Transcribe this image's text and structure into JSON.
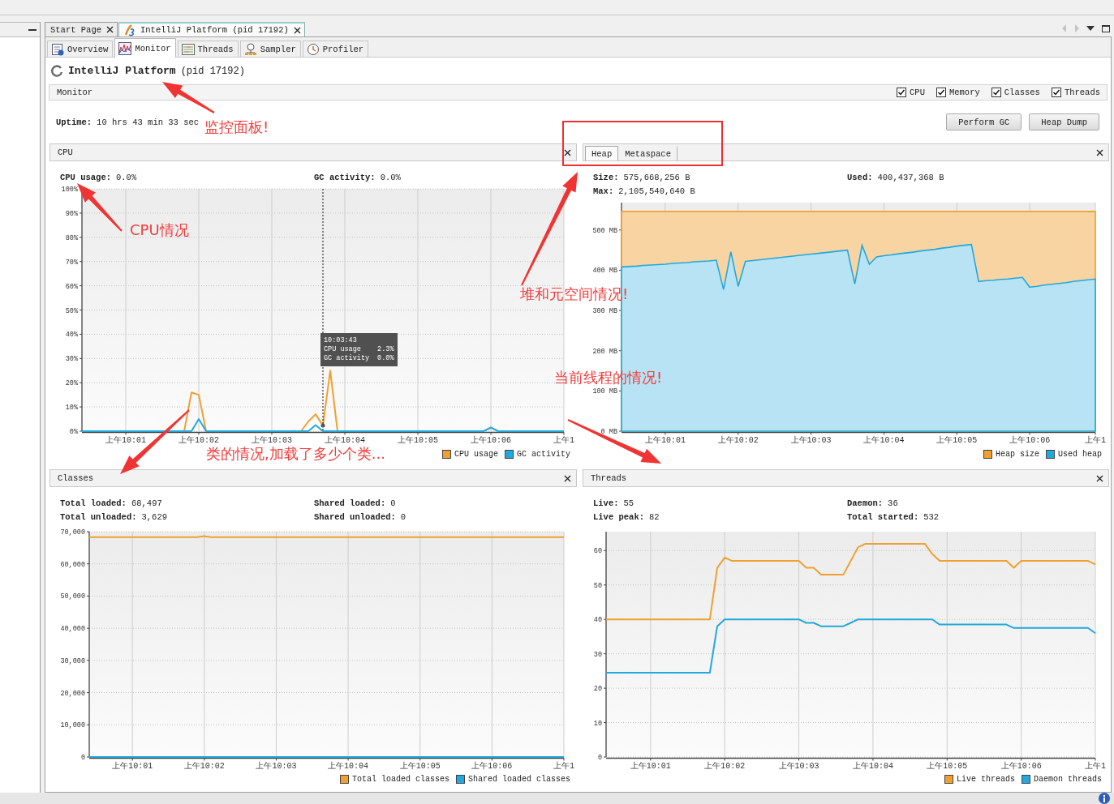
{
  "document_tabs": [
    {
      "label": "Start Page",
      "selected": false,
      "kind": "page"
    },
    {
      "label": "IntelliJ Platform (pid 17192)",
      "selected": true,
      "kind": "application"
    }
  ],
  "view_tabs": [
    {
      "label": "Overview",
      "selected": false,
      "kind": "overview"
    },
    {
      "label": "Monitor",
      "selected": true,
      "kind": "monitor"
    },
    {
      "label": "Threads",
      "selected": false,
      "kind": "threads"
    },
    {
      "label": "Sampler",
      "selected": false,
      "kind": "sampler"
    },
    {
      "label": "Profiler",
      "selected": false,
      "kind": "profiler"
    }
  ],
  "title": {
    "name": "IntelliJ Platform",
    "pid": "(pid 17192)"
  },
  "monitor": {
    "label": "Monitor",
    "options": [
      {
        "label": "CPU",
        "checked": true
      },
      {
        "label": "Memory",
        "checked": true
      },
      {
        "label": "Classes",
        "checked": true
      },
      {
        "label": "Threads",
        "checked": true
      }
    ],
    "uptime_label": "Uptime:",
    "uptime": "10 hrs 43 min 33 sec",
    "buttons": [
      "Perform GC",
      "Heap Dump"
    ]
  },
  "panels": [
    {
      "kind": "cpu",
      "title": "CPU",
      "stats": [
        {
          "label": "CPU usage:",
          "value": "0.0%"
        },
        {
          "label": "GC activity:",
          "value": "0.0%"
        }
      ],
      "chart_data": {
        "type": "line",
        "categories": [
          null,
          null,
          null,
          null,
          null,
          null,
          "上午10:01",
          null,
          null,
          null,
          null,
          null,
          null,
          null,
          null,
          null,
          "上午10:02",
          null,
          null,
          null,
          null,
          null,
          null,
          null,
          null,
          null,
          "上午10:03",
          null,
          null,
          null,
          null,
          null,
          null,
          null,
          null,
          null,
          "上午10:04",
          null,
          null,
          null,
          null,
          null,
          null,
          null,
          null,
          null,
          "上午10:05",
          null,
          null,
          null,
          null,
          null,
          null,
          null,
          null,
          null,
          "上午10:06",
          null,
          null,
          null,
          null,
          null,
          null,
          null,
          null,
          null,
          "上午1"
        ],
        "ylim": [
          0,
          100
        ],
        "series": [
          {
            "name": "CPU usage",
            "color": "#f0a030",
            "values": [
              null,
              null,
              null,
              null,
              null,
              null,
              null,
              null,
              null,
              null,
              null,
              null,
              null,
              null,
              0,
              16,
              15,
              0,
              null,
              null,
              null,
              null,
              null,
              null,
              null,
              null,
              null,
              null,
              null,
              null,
              0,
              4,
              7,
              2.3,
              25,
              0,
              null,
              null,
              null,
              null,
              null,
              null,
              null,
              null,
              null,
              null,
              null,
              null,
              null,
              null,
              null,
              null,
              null,
              null,
              null,
              null,
              null,
              null,
              null,
              null,
              null,
              null,
              null,
              null,
              null,
              null,
              null
            ]
          },
          {
            "name": "GC activity",
            "color": "#22a8dc",
            "values": [
              0,
              0,
              0,
              0,
              0,
              0,
              0,
              0,
              0,
              0,
              0,
              0,
              0,
              0,
              0,
              0,
              5,
              0,
              0,
              0,
              0,
              0,
              0,
              0,
              0,
              0,
              0,
              0,
              0,
              0,
              0,
              0,
              2.5,
              0,
              0,
              0,
              0,
              0,
              0,
              0,
              0,
              0,
              0,
              0,
              0,
              0,
              0,
              0,
              0,
              0,
              0,
              0,
              0,
              0,
              0,
              0,
              1.5,
              0,
              0,
              0,
              0,
              0,
              0,
              0,
              0,
              0,
              0
            ]
          }
        ],
        "yticks": [
          {
            "value": 0,
            "label": "0%"
          },
          {
            "value": 10,
            "label": "10%"
          },
          {
            "value": 20,
            "label": "20%"
          },
          {
            "value": 30,
            "label": "30%"
          },
          {
            "value": 40,
            "label": "40%"
          },
          {
            "value": 50,
            "label": "50%"
          },
          {
            "value": 60,
            "label": "60%"
          },
          {
            "value": 70,
            "label": "70%"
          },
          {
            "value": 80,
            "label": "80%"
          },
          {
            "value": 90,
            "label": "90%"
          },
          {
            "value": 100,
            "label": "100%"
          }
        ],
        "grid": true
      },
      "tooltip": {
        "time": "10:03:43",
        "rows": [
          {
            "label": "CPU usage",
            "value": "2.3%"
          },
          {
            "label": "GC activity",
            "value": "0.0%"
          }
        ]
      }
    },
    {
      "kind": "memory",
      "tabs": [
        {
          "label": "Heap",
          "selected": true
        },
        {
          "label": "Metaspace",
          "selected": false
        }
      ],
      "stats": [
        {
          "label": "Size:",
          "value": "575,668,256 B"
        },
        {
          "label": "Used:",
          "value": "400,437,368 B"
        },
        {
          "label": "Max:",
          "value": "2,105,540,640 B"
        }
      ],
      "chart_data": {
        "type": "area",
        "categories": [
          null,
          null,
          null,
          null,
          null,
          null,
          "上午10:01",
          null,
          null,
          null,
          null,
          null,
          null,
          null,
          null,
          null,
          "上午10:02",
          null,
          null,
          null,
          null,
          null,
          null,
          null,
          null,
          null,
          "上午10:03",
          null,
          null,
          null,
          null,
          null,
          null,
          null,
          null,
          null,
          "上午10:04",
          null,
          null,
          null,
          null,
          null,
          null,
          null,
          null,
          null,
          "上午10:05",
          null,
          null,
          null,
          null,
          null,
          null,
          null,
          null,
          null,
          "上午10:06",
          null,
          null,
          null,
          null,
          null,
          null,
          null,
          null,
          "上午1"
        ],
        "ylim": [
          0,
          568
        ],
        "series": [
          {
            "name": "Heap size",
            "color": "#f0a030",
            "values": [
              546,
              546,
              546,
              546,
              546,
              546,
              546,
              546,
              546,
              546,
              546,
              546,
              546,
              546,
              546,
              546,
              546,
              546,
              546,
              546,
              546,
              546,
              546,
              546,
              546,
              546,
              546,
              546,
              546,
              546,
              546,
              546,
              546,
              546,
              546,
              546,
              546,
              546,
              546,
              546,
              546,
              546,
              546,
              546,
              546,
              546,
              546,
              546,
              546,
              546,
              546,
              546,
              546,
              546,
              546,
              546,
              546,
              546,
              546,
              546,
              546,
              546,
              546,
              546,
              546,
              546
            ]
          },
          {
            "name": "Used heap",
            "color": "#22a8dc",
            "values": [
              408,
              409,
              410,
              412,
              413,
              414,
              415,
              417,
              418,
              419,
              421,
              422,
              423,
              425,
              352,
              446,
              360,
              422,
              424,
              426,
              428,
              430,
              432,
              434,
              436,
              438,
              440,
              442,
              444,
              446,
              448,
              450,
              366,
              462,
              415,
              433,
              436,
              438,
              441,
              443,
              445,
              448,
              450,
              452,
              455,
              457,
              460,
              462,
              464,
              372,
              374,
              375,
              377,
              378,
              380,
              382,
              358,
              360,
              363,
              365,
              367,
              369,
              372,
              374,
              376,
              378
            ]
          }
        ],
        "yticks": [
          {
            "value": 0,
            "label": "0 MB"
          },
          {
            "value": 100,
            "label": "100 MB"
          },
          {
            "value": 200,
            "label": "200 MB"
          },
          {
            "value": 300,
            "label": "300 MB"
          },
          {
            "value": 400,
            "label": "400 MB"
          },
          {
            "value": 500,
            "label": "500 MB"
          }
        ],
        "grid": true
      }
    },
    {
      "kind": "classes",
      "title": "Classes",
      "stats": [
        {
          "label": "Total loaded:",
          "value": "68,497"
        },
        {
          "label": "Shared loaded:",
          "value": "0"
        },
        {
          "label": "Total unloaded:",
          "value": "3,629"
        },
        {
          "label": "Shared unloaded:",
          "value": "0"
        }
      ],
      "chart_data": {
        "type": "line",
        "categories": [
          null,
          null,
          null,
          null,
          null,
          null,
          "上午10:01",
          null,
          null,
          null,
          null,
          null,
          null,
          null,
          null,
          null,
          "上午10:02",
          null,
          null,
          null,
          null,
          null,
          null,
          null,
          null,
          null,
          "上午10:03",
          null,
          null,
          null,
          null,
          null,
          null,
          null,
          null,
          null,
          "上午10:04",
          null,
          null,
          null,
          null,
          null,
          null,
          null,
          null,
          null,
          "上午10:05",
          null,
          null,
          null,
          null,
          null,
          null,
          null,
          null,
          null,
          "上午10:06",
          null,
          null,
          null,
          null,
          null,
          null,
          null,
          null,
          null,
          "上午1"
        ],
        "ylim": [
          0,
          70000
        ],
        "series": [
          {
            "name": "Total loaded classes",
            "color": "#f0a030",
            "values": [
              68300,
              68300,
              68300,
              68300,
              68300,
              68300,
              68300,
              68300,
              68300,
              68300,
              68300,
              68300,
              68300,
              68300,
              68300,
              68300,
              68600,
              68300,
              68300,
              68300,
              68300,
              68300,
              68300,
              68300,
              68300,
              68300,
              68300,
              68300,
              68300,
              68300,
              68300,
              68300,
              68300,
              68300,
              68300,
              68300,
              68300,
              68300,
              68300,
              68300,
              68300,
              68300,
              68300,
              68300,
              68300,
              68300,
              68300,
              68300,
              68300,
              68300,
              68300,
              68300,
              68300,
              68300,
              68300,
              68300,
              68300,
              68300,
              68300,
              68300,
              68300,
              68300,
              68300,
              68300,
              68300,
              68300,
              68300
            ]
          },
          {
            "name": "Shared loaded classes",
            "color": "#22a8dc",
            "values": [
              0,
              0,
              0,
              0,
              0,
              0,
              0,
              0,
              0,
              0,
              0,
              0,
              0,
              0,
              0,
              0,
              0,
              0,
              0,
              0,
              0,
              0,
              0,
              0,
              0,
              0,
              0,
              0,
              0,
              0,
              0,
              0,
              0,
              0,
              0,
              0,
              0,
              0,
              0,
              0,
              0,
              0,
              0,
              0,
              0,
              0,
              0,
              0,
              0,
              0,
              0,
              0,
              0,
              0,
              0,
              0,
              0,
              0,
              0,
              0,
              0,
              0,
              0,
              0,
              0,
              0,
              0
            ]
          }
        ],
        "yticks": [
          {
            "value": 0,
            "label": "0"
          },
          {
            "value": 10000,
            "label": "10,000"
          },
          {
            "value": 20000,
            "label": "20,000"
          },
          {
            "value": 30000,
            "label": "30,000"
          },
          {
            "value": 40000,
            "label": "40,000"
          },
          {
            "value": 50000,
            "label": "50,000"
          },
          {
            "value": 60000,
            "label": "60,000"
          },
          {
            "value": 70000,
            "label": "70,000"
          }
        ],
        "grid": true
      }
    },
    {
      "kind": "threads",
      "title": "Threads",
      "stats": [
        {
          "label": "Live:",
          "value": "55"
        },
        {
          "label": "Daemon:",
          "value": "36"
        },
        {
          "label": "Live peak:",
          "value": "82"
        },
        {
          "label": "Total started:",
          "value": "532"
        }
      ],
      "chart_data": {
        "type": "line",
        "categories": [
          null,
          null,
          null,
          null,
          null,
          null,
          "上午10:01",
          null,
          null,
          null,
          null,
          null,
          null,
          null,
          null,
          null,
          "上午10:02",
          null,
          null,
          null,
          null,
          null,
          null,
          null,
          null,
          null,
          "上午10:03",
          null,
          null,
          null,
          null,
          null,
          null,
          null,
          null,
          null,
          "上午10:04",
          null,
          null,
          null,
          null,
          null,
          null,
          null,
          null,
          null,
          "上午10:05",
          null,
          null,
          null,
          null,
          null,
          null,
          null,
          null,
          null,
          "上午10:06",
          null,
          null,
          null,
          null,
          null,
          null,
          null,
          null,
          null,
          "上午1"
        ],
        "ylim": [
          0,
          65.5
        ],
        "series": [
          {
            "name": "Live threads",
            "color": "#f0a030",
            "values": [
              40,
              40,
              40,
              40,
              40,
              40,
              40,
              40,
              40,
              40,
              40,
              40,
              40,
              40,
              40,
              55,
              58,
              57,
              57,
              57,
              57,
              57,
              57,
              57,
              57,
              57,
              57,
              55,
              55,
              53,
              53,
              53,
              53,
              57,
              61,
              62,
              62,
              62,
              62,
              62,
              62,
              62,
              62,
              62,
              59,
              57,
              57,
              57,
              57,
              57,
              57,
              57,
              57,
              57,
              57,
              55,
              57,
              57,
              57,
              57,
              57,
              57,
              57,
              57,
              57,
              57,
              56
            ]
          },
          {
            "name": "Daemon threads",
            "color": "#22a8dc",
            "values": [
              24.5,
              24.5,
              24.5,
              24.5,
              24.5,
              24.5,
              24.5,
              24.5,
              24.5,
              24.5,
              24.5,
              24.5,
              24.5,
              24.5,
              24.5,
              38,
              40,
              40,
              40,
              40,
              40,
              40,
              40,
              40,
              40,
              40,
              40,
              39,
              39,
              38,
              38,
              38,
              38,
              39,
              40,
              40,
              40,
              40,
              40,
              40,
              40,
              40,
              40,
              40,
              40,
              38.5,
              38.5,
              38.5,
              38.5,
              38.5,
              38.5,
              38.5,
              38.5,
              38.5,
              38.5,
              37.5,
              37.5,
              37.5,
              37.5,
              37.5,
              37.5,
              37.5,
              37.5,
              37.5,
              37.5,
              37.5,
              36
            ]
          }
        ],
        "yticks": [
          {
            "value": 0,
            "label": "0"
          },
          {
            "value": 10,
            "label": "10"
          },
          {
            "value": 20,
            "label": "20"
          },
          {
            "value": 30,
            "label": "30"
          },
          {
            "value": 40,
            "label": "40"
          },
          {
            "value": 50,
            "label": "50"
          },
          {
            "value": 60,
            "label": "60"
          }
        ],
        "grid": true
      }
    }
  ],
  "annotations": [
    {
      "text": "监控面板!"
    },
    {
      "text": "CPU情况"
    },
    {
      "text": "堆和元空间情况!"
    },
    {
      "text": "当前线程的情况!"
    },
    {
      "text": "类的情况,加载了多少个类..."
    }
  ]
}
